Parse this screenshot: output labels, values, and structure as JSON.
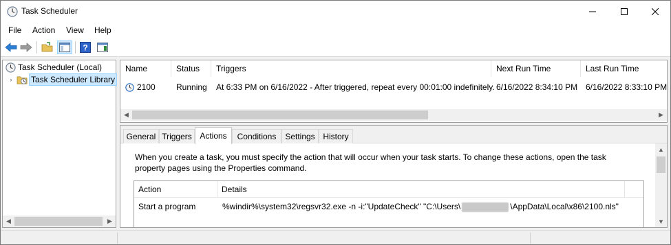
{
  "window": {
    "title": "Task Scheduler",
    "icon": "clock-icon"
  },
  "menu": [
    "File",
    "Action",
    "View",
    "Help"
  ],
  "toolbar": {
    "buttons": [
      "back-arrow-icon",
      "forward-arrow-icon",
      "open-folder-icon",
      "show-hide-console-tree-icon",
      "help-icon",
      "show-action-pane-icon"
    ]
  },
  "tree": {
    "root": "Task Scheduler (Local)",
    "library": "Task Scheduler Library"
  },
  "tasks": {
    "columns": [
      "Name",
      "Status",
      "Triggers",
      "Next Run Time",
      "Last Run Time"
    ],
    "rows": [
      {
        "name": "2100",
        "status": "Running",
        "triggers": "At 6:33 PM on 6/16/2022 - After triggered, repeat every 00:01:00 indefinitely.",
        "next_run": "6/16/2022 8:34:10 PM",
        "last_run": "6/16/2022 8:33:10 PM"
      }
    ]
  },
  "detail": {
    "tabs": [
      "General",
      "Triggers",
      "Actions",
      "Conditions",
      "Settings",
      "History"
    ],
    "active_tab": "Actions",
    "description_line1": "When you create a task, you must specify the action that will occur when your task starts.  To change these actions, open the task",
    "description_line2": "property pages using the Properties command.",
    "actions_columns": [
      "Action",
      "Details"
    ],
    "actions_rows": [
      {
        "action": "Start a program",
        "details_prefix": "%windir%\\system32\\regsvr32.exe -n -i:\"UpdateCheck\" \"C:\\Users\\",
        "details_suffix": "\\AppData\\Local\\x86\\2100.nls\""
      }
    ]
  },
  "colors": {
    "selection": "#cce8ff",
    "border": "#a0a0a0",
    "chrome": "#f0f0f0"
  }
}
